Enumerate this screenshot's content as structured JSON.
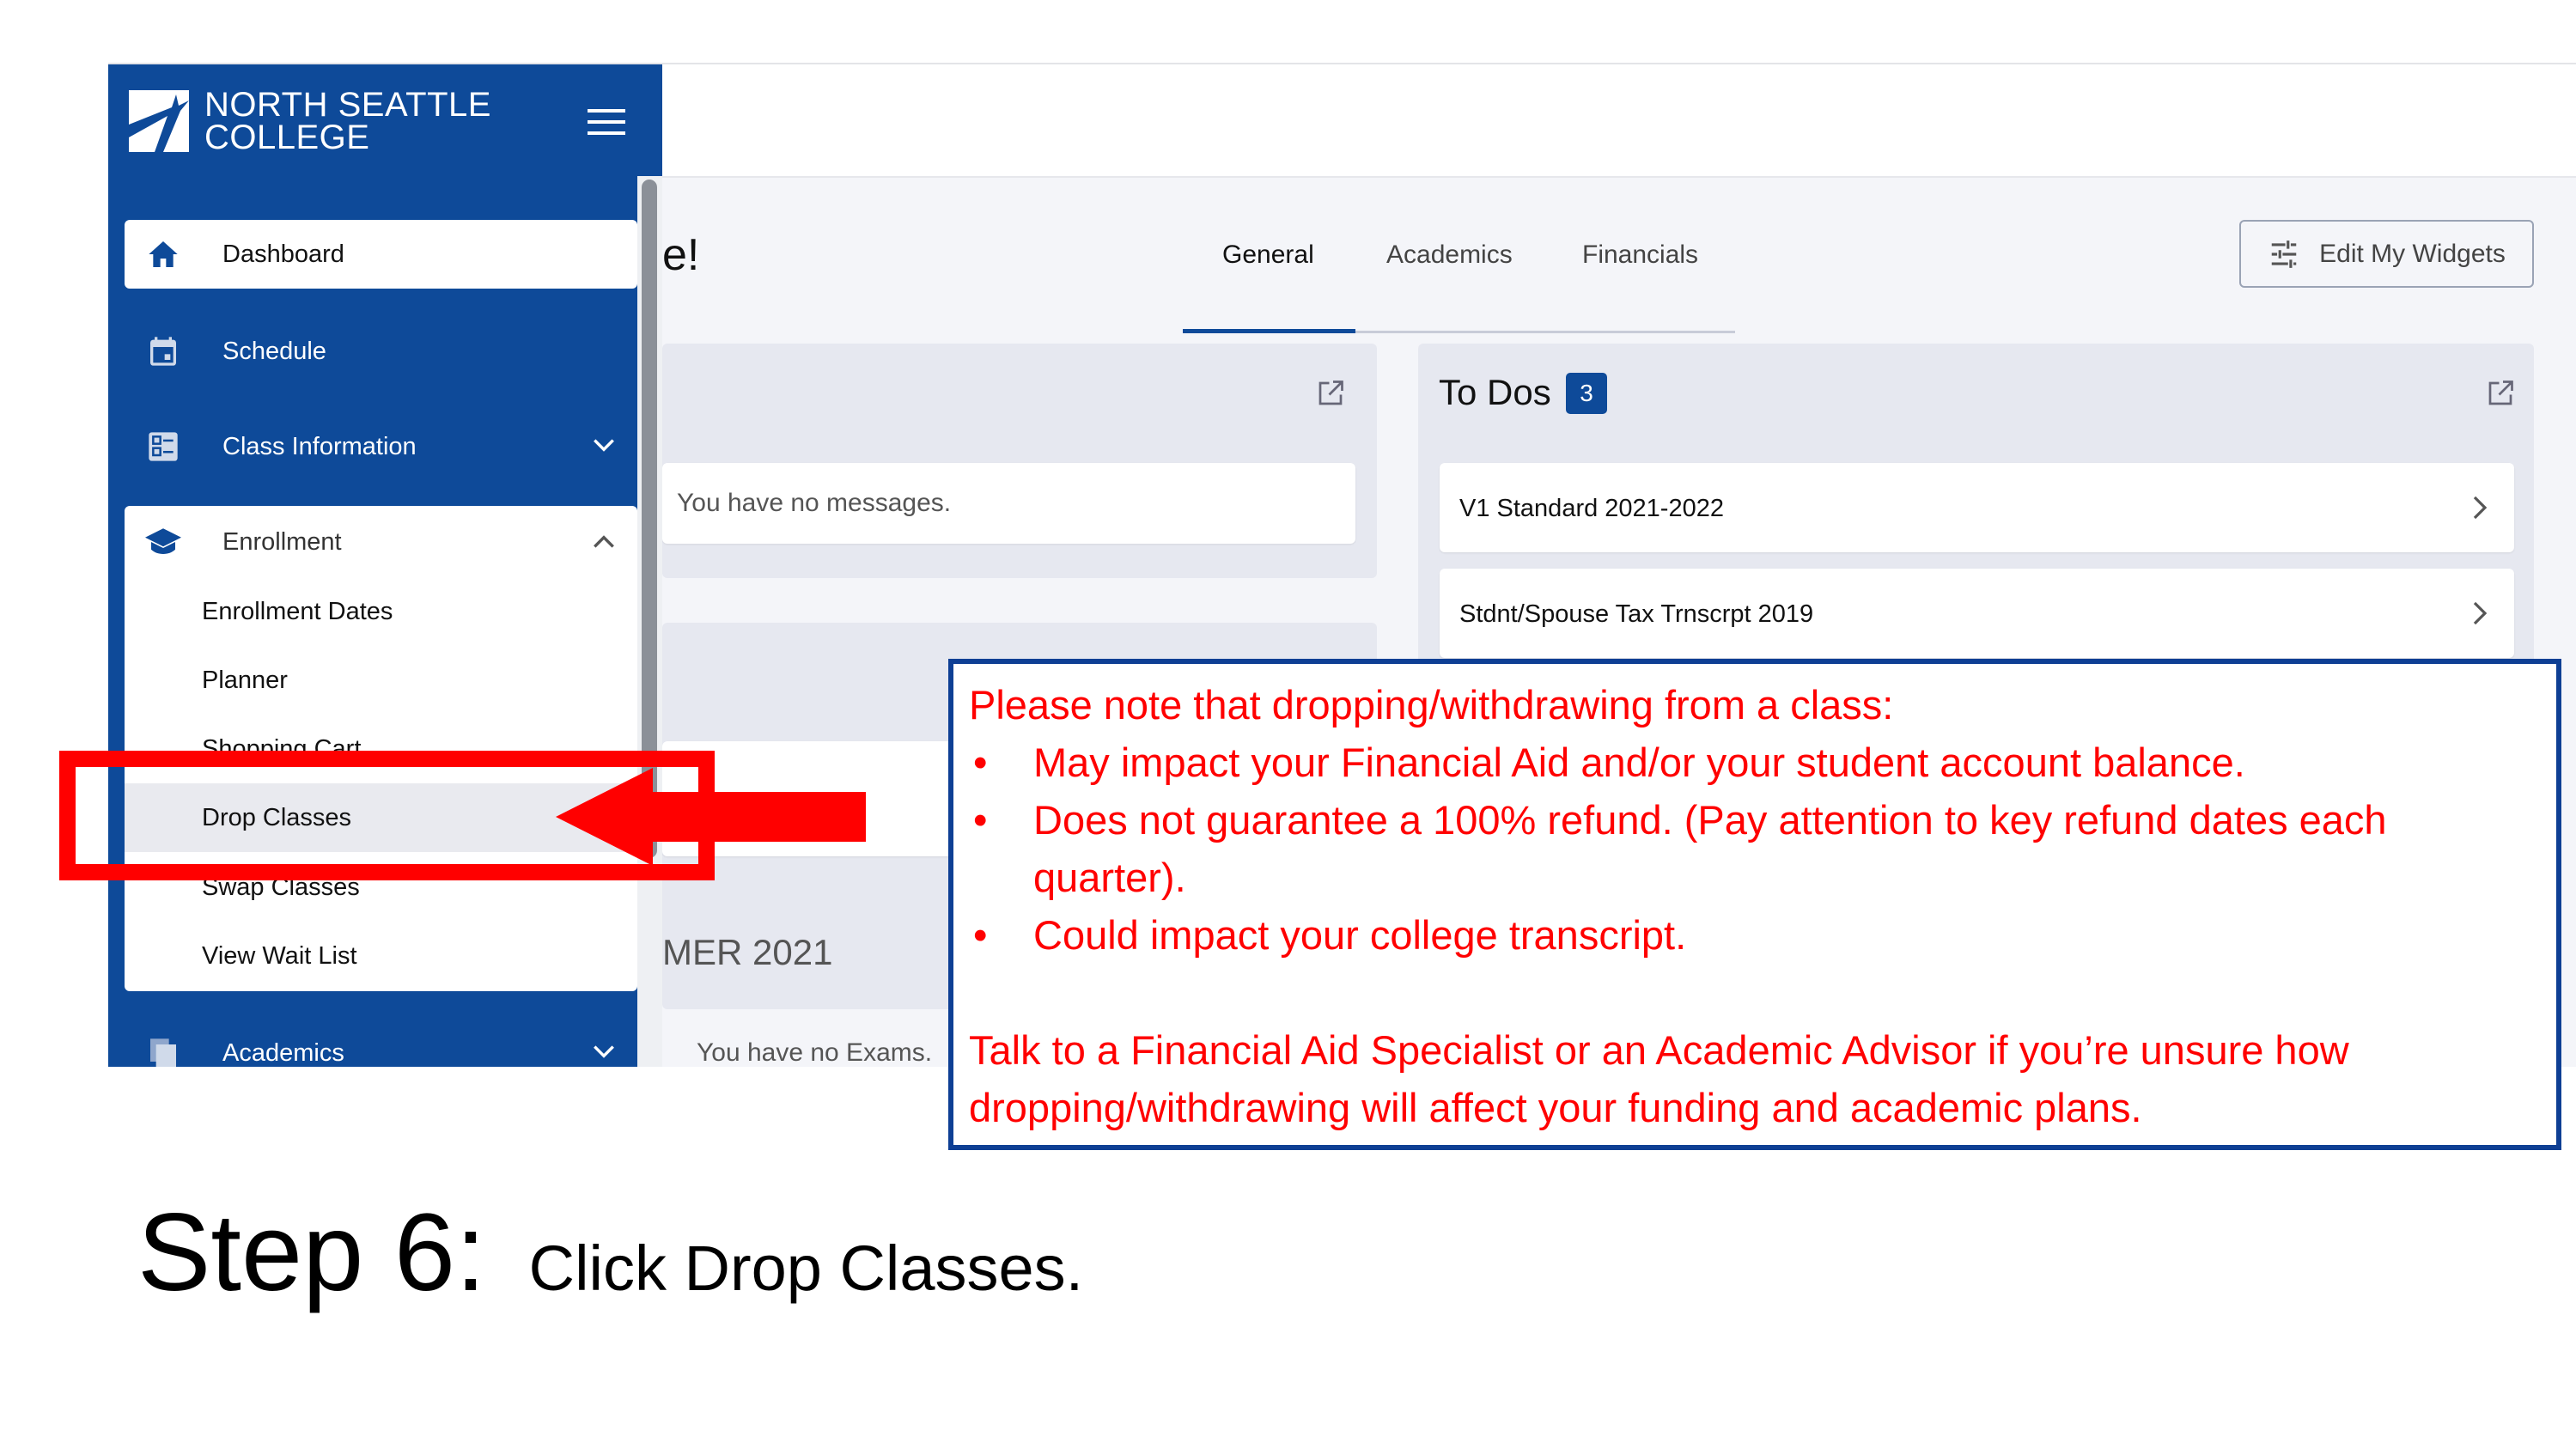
{
  "sidebar": {
    "logo_text": [
      "NORTH SEATTLE",
      "COLLEGE"
    ],
    "items": [
      {
        "label": "Dashboard",
        "icon": "home-icon"
      },
      {
        "label": "Schedule",
        "icon": "calendar-icon"
      },
      {
        "label": "Class Information",
        "icon": "list-icon"
      },
      {
        "label": "Enrollment",
        "icon": "graduation-cap-icon"
      },
      {
        "label": "Academics",
        "icon": "document-icon"
      }
    ],
    "enrollment_subitems": [
      "Enrollment Dates",
      "Planner",
      "Shopping Cart",
      "Drop Classes",
      "Swap Classes",
      "View Wait List"
    ]
  },
  "header": {
    "greeting_fragment": "e!"
  },
  "tabs": [
    {
      "label": "General",
      "active": true
    },
    {
      "label": "Academics"
    },
    {
      "label": "Financials"
    }
  ],
  "edit_widgets_label": "Edit My Widgets",
  "messages": {
    "empty_text": "You have no messages."
  },
  "exams": {
    "term_fragment": "MER 2021",
    "empty_text": "You have no Exams."
  },
  "todos": {
    "title": "To Dos",
    "count": "3",
    "items": [
      "V1 Standard 2021-2022",
      "Stdnt/Spouse Tax Trnscrpt 2019"
    ]
  },
  "note": {
    "intro": "Please note that dropping/withdrawing from a class:",
    "bullets": [
      "May impact your Financial Aid and/or your student account balance.",
      "Does not guarantee a 100% refund. (Pay attention to key refund dates each quarter).",
      "Could impact your college transcript."
    ],
    "footer": "Talk to a Financial Aid Specialist or an Academic Advisor if you’re unsure how dropping/withdrawing will affect your funding and academic plans."
  },
  "step": {
    "label": "Step 6:",
    "instruction": "Click Drop Classes."
  },
  "colors": {
    "brand_blue": "#0e4a99",
    "annotation_red": "#ff0000",
    "note_border": "#0e3f94"
  }
}
